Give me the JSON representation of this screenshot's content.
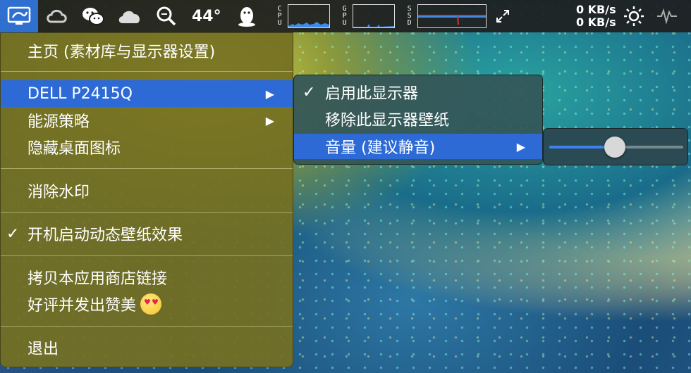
{
  "menubar": {
    "temperature": "44°",
    "cpu_label": [
      "C",
      "P",
      "U"
    ],
    "gpu_label": [
      "G",
      "P",
      "U"
    ],
    "ssd_label": [
      "S",
      "S",
      "D"
    ],
    "net_up": "0 KB/s",
    "net_down": "0 KB/s",
    "icons": [
      "display-app-icon",
      "creative-cloud-icon",
      "wechat-icon",
      "cloud-icon",
      "search-icon",
      "qq-penguin-icon",
      "resize-arrows-icon",
      "brightness-icon",
      "signal-icon"
    ]
  },
  "menu": {
    "home": "主页 (素材库与显示器设置)",
    "display": "DELL P2415Q",
    "energy": "能源策略",
    "hide_icons": "隐藏桌面图标",
    "remove_watermark": "消除水印",
    "launch_at_login_check": "✓",
    "launch_at_login": "开机启动动态壁纸效果",
    "copy_link": "拷贝本应用商店链接",
    "review": "好评并发出赞美",
    "quit": "退出",
    "arrow": "▶"
  },
  "submenu": {
    "enable_check": "✓",
    "enable": "启用此显示器",
    "remove_wallpaper": "移除此显示器壁纸",
    "volume": "音量 (建议静音)",
    "arrow": "▶"
  },
  "volume_slider": {
    "value_fraction": 0.49
  },
  "colors": {
    "selection": "#2d6ad6",
    "menubar": "#1e1e1e",
    "accent": "#3d82f0"
  }
}
